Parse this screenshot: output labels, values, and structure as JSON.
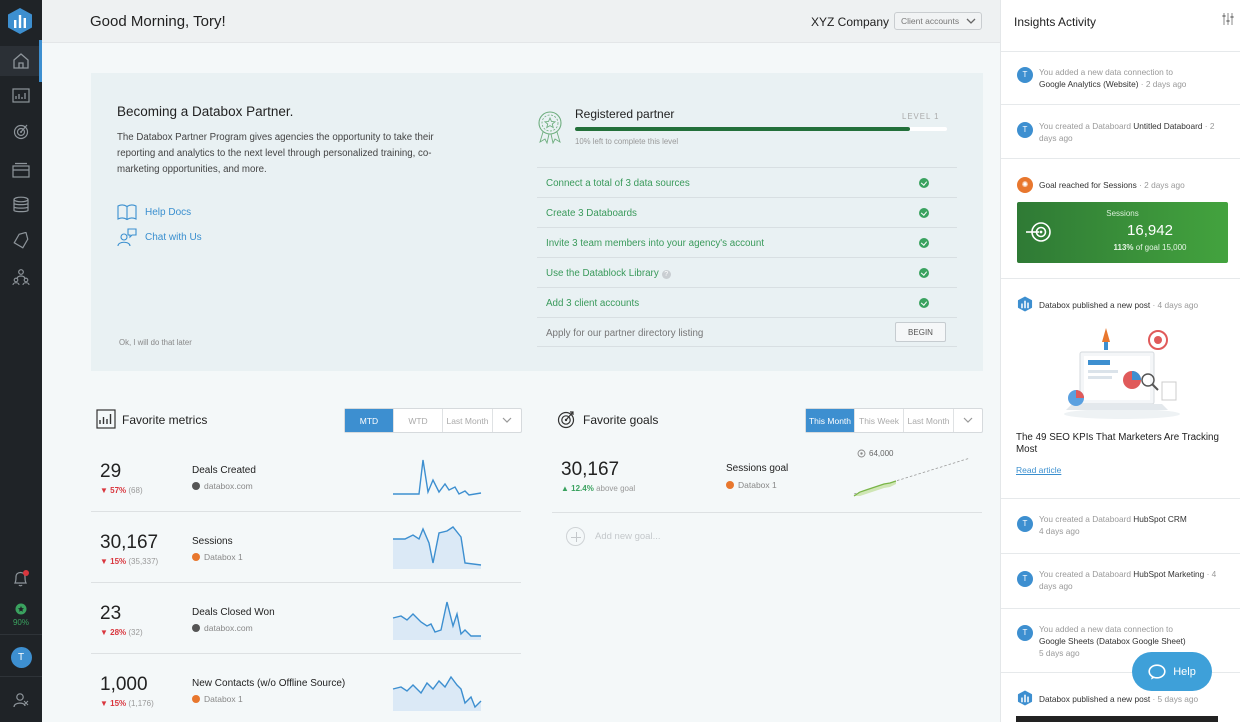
{
  "header": {
    "greeting": "Good Morning, Tory!",
    "company": "XYZ Company",
    "client_select": "Client accounts"
  },
  "sidebar": {
    "items": [
      "home-icon",
      "databoards-icon",
      "goals-icon",
      "datablocks-icon",
      "data-sources-icon",
      "alerts-icon",
      "team-icon"
    ],
    "bottom": {
      "progress": "90%",
      "user_initial": "T"
    }
  },
  "partner": {
    "title": "Becoming a Databox Partner.",
    "description": "The Databox Partner Program gives agencies the opportunity to take their reporting and analytics to the next level through personalized training, co-marketing opportunities, and more.",
    "links": [
      "Help Docs",
      "Chat with Us"
    ],
    "later": "Ok, I will do that later",
    "registered_title": "Registered partner",
    "level": "LEVEL 1",
    "progress": 0.9,
    "progress_text": "10% left to complete this level",
    "tasks": [
      {
        "label": "Connect a total of 3 data sources",
        "done": true
      },
      {
        "label": "Create 3 Databoards",
        "done": true
      },
      {
        "label": "Invite 3 team members into your agency's account",
        "done": true
      },
      {
        "label": "Use the Datablock Library",
        "done": true
      },
      {
        "label": "Add 3 client accounts",
        "done": true
      },
      {
        "label": "Apply for our partner directory listing",
        "done": false,
        "action": "BEGIN"
      }
    ]
  },
  "metrics": {
    "title": "Favorite metrics",
    "tabs": [
      "MTD",
      "WTD",
      "Last Month"
    ],
    "rows": [
      {
        "value": "29",
        "change": "▼ 57%",
        "prev": "(68)",
        "name": "Deals Created",
        "source": "databox.com"
      },
      {
        "value": "30,167",
        "change": "▼ 15%",
        "prev": "(35,337)",
        "name": "Sessions",
        "source": "Databox 1"
      },
      {
        "value": "23",
        "change": "▼ 28%",
        "prev": "(32)",
        "name": "Deals Closed Won",
        "source": "databox.com"
      },
      {
        "value": "1,000",
        "change": "▼ 15%",
        "prev": "(1,176)",
        "name": "New Contacts (w/o Offline Source)",
        "source": "Databox 1"
      }
    ]
  },
  "goals": {
    "title": "Favorite goals",
    "tabs": [
      "This Month",
      "This Week",
      "Last Month"
    ],
    "row": {
      "value": "30,167",
      "change": "▲ 12.4%",
      "change_label": "above goal",
      "name": "Sessions goal",
      "source": "Databox 1",
      "target": "64,000"
    },
    "add": "Add new goal..."
  },
  "insights": {
    "title": "Insights Activity",
    "feed": [
      {
        "pre": "You added a new data connection to",
        "name": "Google Analytics (Website)",
        "time": "2 days ago"
      },
      {
        "pre": "You created a Databoard",
        "name": "Untitled Databoard",
        "time": "2 days ago"
      },
      {
        "pre": "Goal reached for Sessions",
        "time": "2 days ago"
      },
      {
        "pre": "Databox published a new post",
        "time": "4 days ago"
      },
      {
        "pre": "You created a Databoard",
        "name": "HubSpot CRM",
        "time": "4 days ago"
      },
      {
        "pre": "You created a Databoard",
        "name": "HubSpot Marketing",
        "time": "4 days ago"
      },
      {
        "pre": "You added a new data connection to",
        "name": "Google Sheets (Databox Google Sheet)",
        "time": "5 days ago"
      },
      {
        "pre": "Databox published a new post",
        "time": "5 days ago"
      }
    ],
    "sessions_card": {
      "label": "Sessions",
      "value": "16,942",
      "pct": "113%",
      "goal_text": "of goal 15,000"
    },
    "blog": {
      "title": "The 49 SEO KPIs That Marketers Are Tracking Most",
      "link": "Read article"
    },
    "initial": "T"
  },
  "help": "Help",
  "colors": {
    "accent": "#3d8fd0",
    "success": "#3aa25f",
    "danger": "#d9363e",
    "sidebar": "#1f2327",
    "progress": "#23703a"
  }
}
